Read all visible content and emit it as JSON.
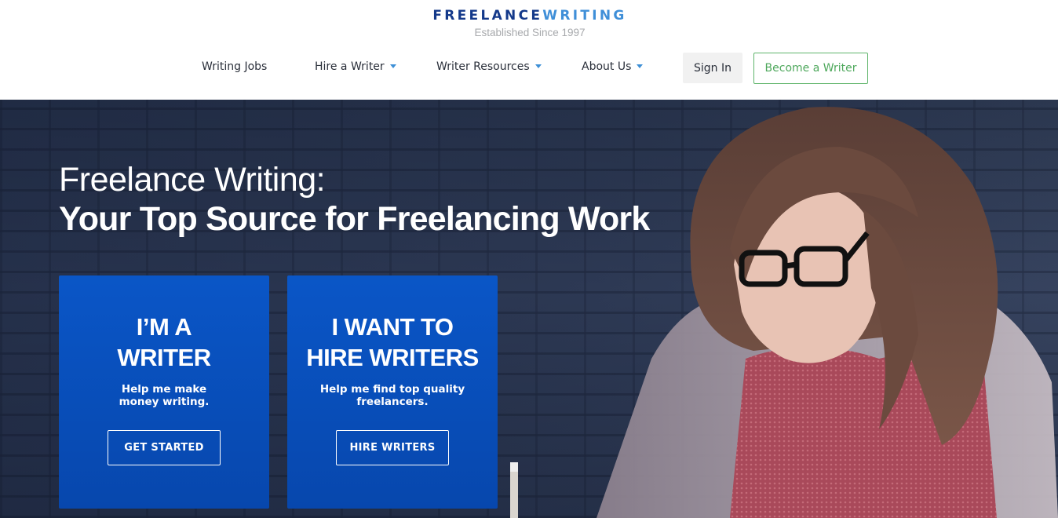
{
  "header": {
    "logo_part1": "FREELANCE",
    "logo_part2": "WRITING",
    "tagline": "Established Since 1997",
    "nav": [
      {
        "label": "Writing Jobs",
        "has_dropdown": false
      },
      {
        "label": "Hire a Writer",
        "has_dropdown": true
      },
      {
        "label": "Writer Resources",
        "has_dropdown": true
      },
      {
        "label": "About Us",
        "has_dropdown": true
      }
    ],
    "sign_in": "Sign In",
    "become_writer": "Become a Writer"
  },
  "hero": {
    "title_line1": "Freelance Writing:",
    "title_line2": "Your Top Source for Freelancing Work",
    "cards": [
      {
        "title_line1": "I’M A",
        "title_line2": "WRITER",
        "desc_line1": "Help me make",
        "desc_line2": "money writing.",
        "button": "GET STARTED"
      },
      {
        "title_line1": "I WANT TO",
        "title_line2": "HIRE WRITERS",
        "desc_line1": "Help me find top quality",
        "desc_line2": "freelancers.",
        "button": "HIRE WRITERS"
      }
    ]
  },
  "colors": {
    "brand_dark": "#14398a",
    "brand_light": "#3f8fd8",
    "card_blue": "#0a56c7",
    "accent_green": "#4ea85c"
  }
}
